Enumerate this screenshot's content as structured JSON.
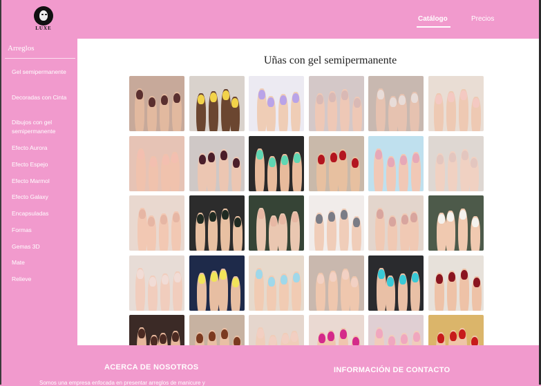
{
  "header": {
    "logo_text": "LUXE",
    "nav": [
      {
        "label": "Catálogo",
        "active": true
      },
      {
        "label": "Precios",
        "active": false
      }
    ]
  },
  "sidebar": {
    "title": "Arreglos",
    "items": [
      {
        "label": "Gel semipermanente"
      },
      {
        "label": "Decoradas con Cinta"
      },
      {
        "label": "Dibujos con gel semipermanente"
      },
      {
        "label": "Efecto Aurora"
      },
      {
        "label": "Efecto Espejo"
      },
      {
        "label": "Efecto Marmol"
      },
      {
        "label": "Efecto Galaxy"
      },
      {
        "label": "Encapsuladas"
      },
      {
        "label": "Formas"
      },
      {
        "label": "Gemas 3D"
      },
      {
        "label": "Mate"
      },
      {
        "label": "Relieve"
      }
    ]
  },
  "main": {
    "title": "Uñas con gel semipermanente",
    "gallery": [
      {
        "bg": "#c7a99a",
        "skin": "#e2b99f",
        "nail": "#5a2f2f"
      },
      {
        "bg": "#d9d2cc",
        "skin": "#6b4630",
        "nail": "#f2d34a"
      },
      {
        "bg": "#eceaf2",
        "skin": "#efcdb6",
        "nail": "#b9a3e8"
      },
      {
        "bg": "#d4c8c8",
        "skin": "#eec8b6",
        "nail": "#d9b9b5"
      },
      {
        "bg": "#c8b8b0",
        "skin": "#e6c2b0",
        "nail": "#e8dcd8"
      },
      {
        "bg": "#e9ddd4",
        "skin": "#eec9b3",
        "nail": "#f4c9c2"
      },
      {
        "bg": "#e6c3b5",
        "skin": "#f0c2ad",
        "nail": "#f3bfb0"
      },
      {
        "bg": "#cfc8c6",
        "skin": "#ecc6b2",
        "nail": "#4a1e2a"
      },
      {
        "bg": "#2b2a2a",
        "skin": "#e8bb9c",
        "nail": "#5fd6b2"
      },
      {
        "bg": "#c9b9aa",
        "skin": "#e7c0a0",
        "nail": "#b3151f"
      },
      {
        "bg": "#bfe0ee",
        "skin": "#f1c8b6",
        "nail": "#e6a8b8"
      },
      {
        "bg": "#ded7d2",
        "skin": "#f0d1c2",
        "nail": "#e3c6bf"
      },
      {
        "bg": "#e9d8cf",
        "skin": "#f2c8b3",
        "nail": "#e6b6a4"
      },
      {
        "bg": "#2c2c2c",
        "skin": "#e8c0a2",
        "nail": "#1f2a22"
      },
      {
        "bg": "#364436",
        "skin": "#eac7b1",
        "nail": "#e7b8a4"
      },
      {
        "bg": "#f1ecea",
        "skin": "#f0cdb9",
        "nail": "#7a7c86"
      },
      {
        "bg": "#e3d5cc",
        "skin": "#f0c9b4",
        "nail": "#d8a59e"
      },
      {
        "bg": "#4d5a4a",
        "skin": "#f0c9b0",
        "nail": "#f4f2ee"
      },
      {
        "bg": "#e7dcd6",
        "skin": "#f1cdbd",
        "nail": "#f1dcd6"
      },
      {
        "bg": "#1e2a4a",
        "skin": "#e7bea2",
        "nail": "#f1e45a"
      },
      {
        "bg": "#e6d9cc",
        "skin": "#f1cbb3",
        "nail": "#9fd8ea"
      },
      {
        "bg": "#c9b8ae",
        "skin": "#efc7ae",
        "nail": "#f2d1c4"
      },
      {
        "bg": "#2a2b2e",
        "skin": "#e9c0a6",
        "nail": "#39c9d6"
      },
      {
        "bg": "#e7e1da",
        "skin": "#eec2a7",
        "nail": "#8a1520"
      },
      {
        "bg": "#3b2a26",
        "skin": "#e6b79b",
        "nail": "#4b2a22"
      },
      {
        "bg": "#c7b2a1",
        "skin": "#e9bfa4",
        "nail": "#7b3a20"
      },
      {
        "bg": "#e5d6cd",
        "skin": "#f0cdb9",
        "nail": "#f2cfc2"
      },
      {
        "bg": "#ead9d2",
        "skin": "#f0c5ae",
        "nail": "#d42a8a"
      },
      {
        "bg": "#e0cfd3",
        "skin": "#f1ccbb",
        "nail": "#f0a7bf"
      },
      {
        "bg": "#dbb56a",
        "skin": "#efc5a8",
        "nail": "#c71b1b"
      }
    ]
  },
  "footer": {
    "about_heading": "ACERCA DE NOSOTROS",
    "contact_heading": "INFORMACIÓN DE CONTACTO",
    "about_text": "Somos una empresa enfocada en presentar arreglos de manicure y"
  }
}
